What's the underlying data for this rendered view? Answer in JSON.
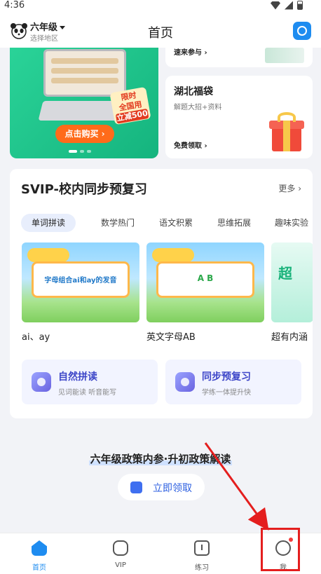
{
  "status_bar": {
    "time": "4:36"
  },
  "header": {
    "grade": "六年级",
    "region": "选择地区",
    "title": "首页"
  },
  "promo": {
    "badge": [
      "限时",
      "全国用",
      "立减500"
    ],
    "buy_label": "点击购买 ›"
  },
  "join_card": {
    "label": "速来参与 ›"
  },
  "hubei_card": {
    "title": "湖北福袋",
    "subtitle": "解题大招+资料",
    "link": "免费领取 ›"
  },
  "svip": {
    "title": "SVIP-校内同步预复习",
    "more": "更多 ›",
    "tabs": [
      "单词拼读",
      "数学热门",
      "语文积累",
      "思维拓展",
      "趣味实验"
    ],
    "lessons": [
      {
        "caption": "ai、ay",
        "board": "字母组合ai和ay的发音"
      },
      {
        "caption": "英文字母AB",
        "board": "A B"
      },
      {
        "caption": "超有内涵",
        "board": "超"
      }
    ],
    "features": [
      {
        "title": "自然拼读",
        "subtitle": "见词能读 听音能写"
      },
      {
        "title": "同步预复习",
        "subtitle": "学练一体提升快"
      }
    ]
  },
  "policy": {
    "title": "六年级政策内参·升初政策解读",
    "claim_label": "立即领取"
  },
  "tabbar": {
    "items": [
      "首页",
      "VIP",
      "练习",
      "我"
    ]
  },
  "colors": {
    "accent": "#1e8cf0",
    "promo_green": "#2ad398",
    "annotation_red": "#e41e1e"
  }
}
